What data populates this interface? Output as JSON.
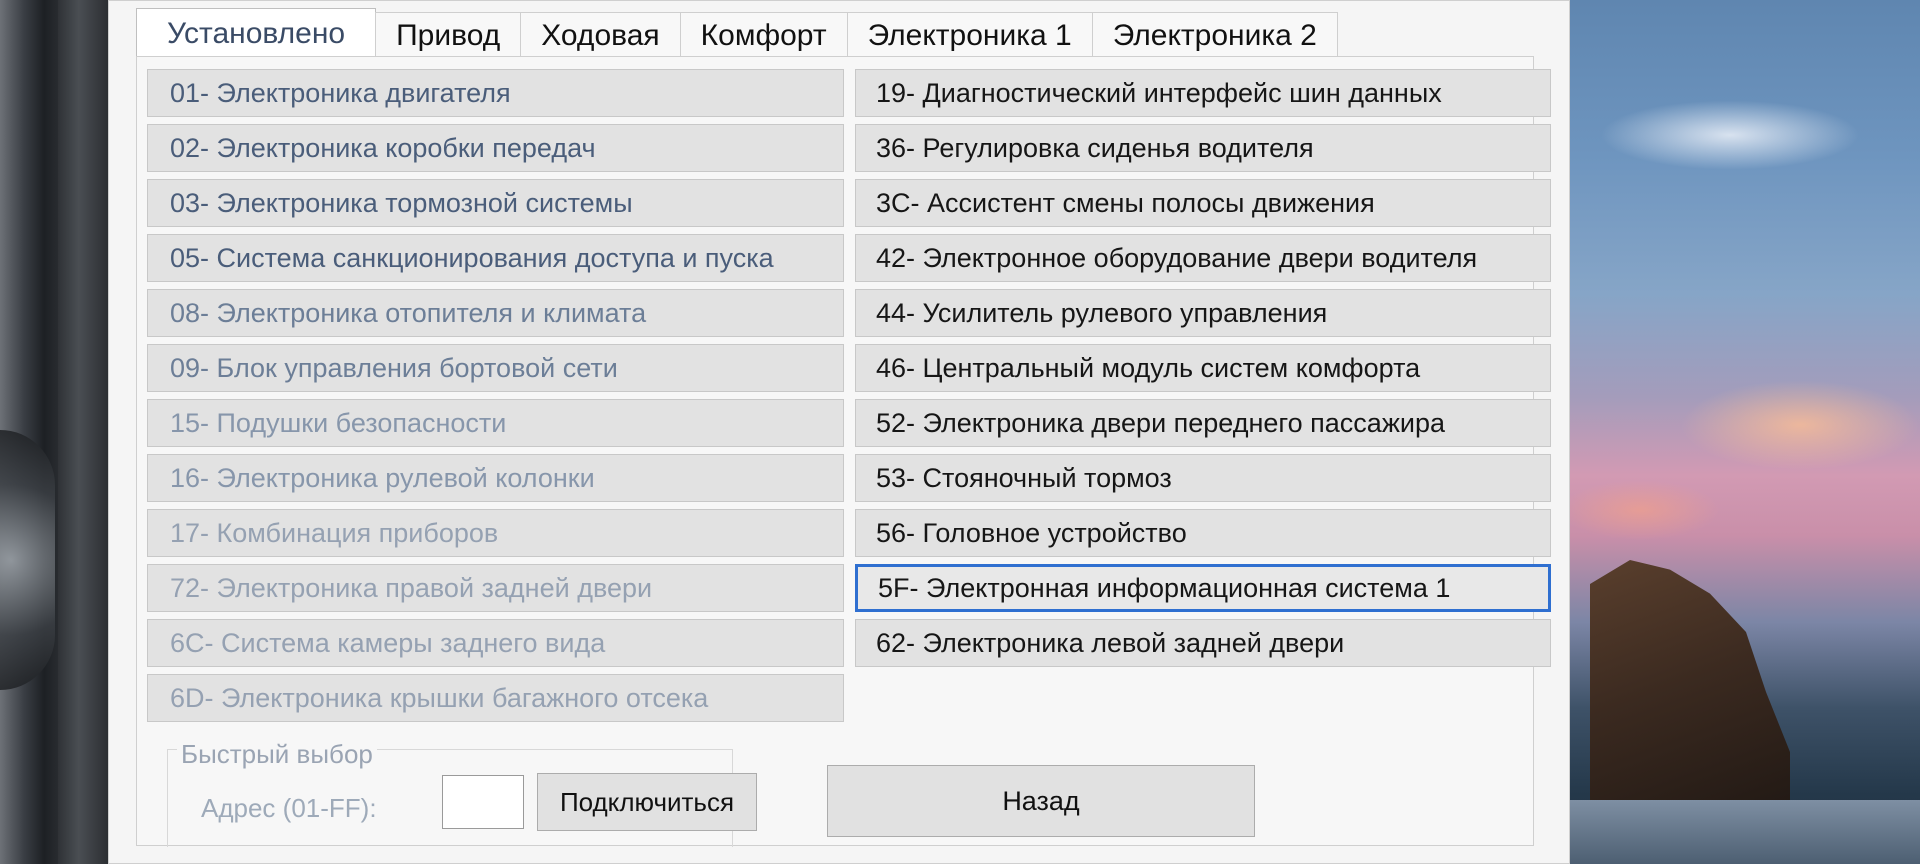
{
  "tabs": [
    {
      "label": "Установлено",
      "active": true
    },
    {
      "label": "Привод"
    },
    {
      "label": "Ходовая"
    },
    {
      "label": "Комфорт"
    },
    {
      "label": "Электроника 1"
    },
    {
      "label": "Электроника 2"
    }
  ],
  "left_items": [
    "01- Электроника двигателя",
    "02- Электроника коробки передач",
    "03- Электроника тормозной системы",
    "05- Система санкционирования доступа и пуска",
    "08- Электроника отопителя и климата",
    "09- Блок управления бортовой сети",
    "15- Подушки безопасности",
    "16- Электроника рулевой колонки",
    "17- Комбинация приборов",
    "72- Электроника правой задней двери",
    "6C- Система камеры заднего вида",
    "6D- Электроника крышки багажного отсека"
  ],
  "right_items": [
    "19- Диагностический интерфейс шин данных",
    "36- Регулировка сиденья водителя",
    "3C- Ассистент смены полосы движения",
    "42- Электронное оборудование двери водителя",
    "44- Усилитель рулевого управления",
    "46- Центральный модуль систем комфорта",
    "52- Электроника двери переднего пассажира",
    "53- Стояночный тормоз",
    "56- Головное устройство",
    "5F- Электронная информационная система 1",
    "62- Электроника левой задней двери"
  ],
  "selected_item": "5F- Электронная информационная система 1",
  "quick_select": {
    "legend": "Быстрый выбор",
    "address_label": "Адрес (01-FF):",
    "address_value": "",
    "connect_label": "Подключиться"
  },
  "back_label": "Назад",
  "colors": {
    "selection_border": "#2f6fd0",
    "window_bg": "#f5f5f5",
    "item_bg": "#e2e2e2"
  }
}
